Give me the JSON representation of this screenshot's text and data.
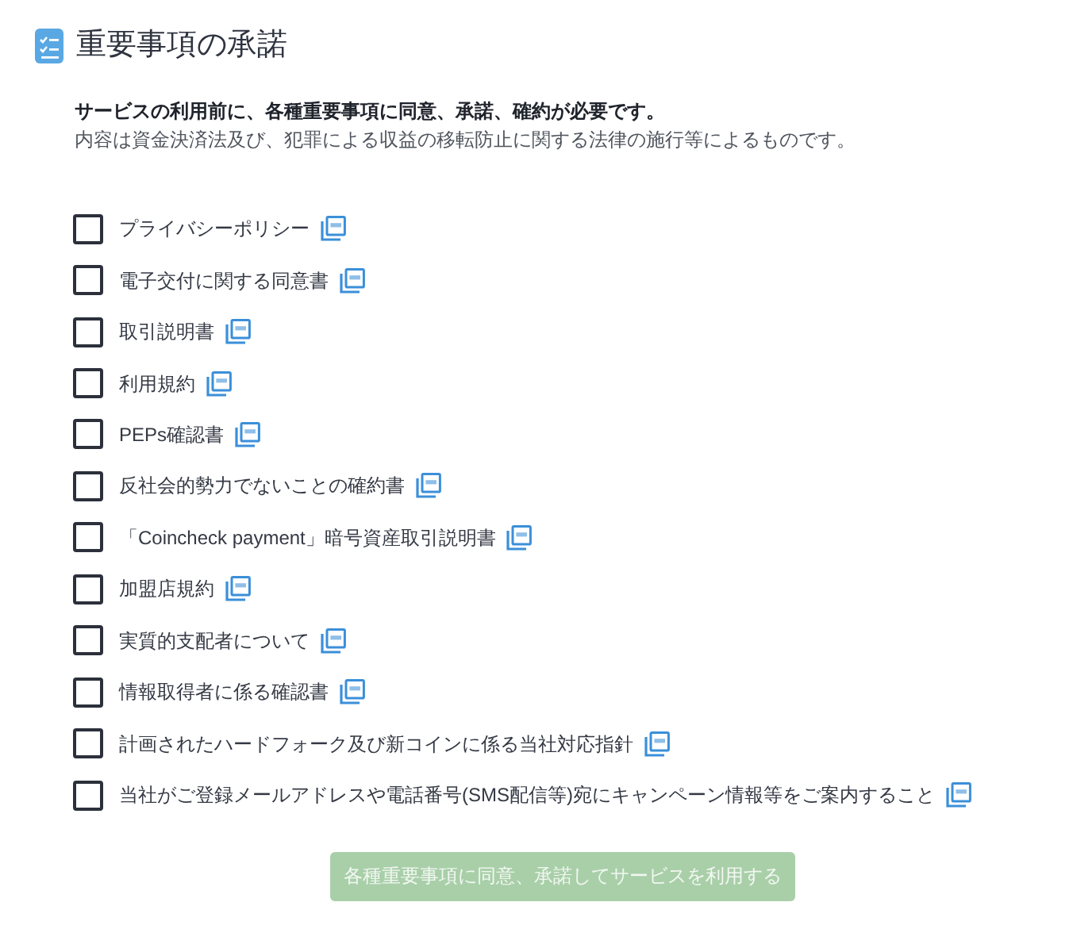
{
  "header": {
    "title": "重要事項の承諾"
  },
  "intro": {
    "lead": "サービスの利用前に、各種重要事項に同意、承諾、確約が必要です。",
    "note": "内容は資金決済法及び、犯罪による収益の移転防止に関する法律の施行等によるものです。"
  },
  "documents": [
    {
      "label": "プライバシーポリシー",
      "checked": false
    },
    {
      "label": "電子交付に関する同意書",
      "checked": false
    },
    {
      "label": "取引説明書",
      "checked": false
    },
    {
      "label": "利用規約",
      "checked": false
    },
    {
      "label": "PEPs確認書",
      "checked": false
    },
    {
      "label": "反社会的勢力でないことの確約書",
      "checked": false
    },
    {
      "label": "「Coincheck payment」暗号資産取引説明書",
      "checked": false
    },
    {
      "label": "加盟店規約",
      "checked": false
    },
    {
      "label": "実質的支配者について",
      "checked": false
    },
    {
      "label": "情報取得者に係る確認書",
      "checked": false
    },
    {
      "label": "計画されたハードフォーク及び新コインに係る当社対応指針",
      "checked": false
    },
    {
      "label": "当社がご登録メールアドレスや電話番号(SMS配信等)宛にキャンペーン情報等をご案内すること",
      "checked": false
    }
  ],
  "submit_button": {
    "label": "各種重要事項に同意、承諾してサービスを利用する",
    "disabled": true
  }
}
